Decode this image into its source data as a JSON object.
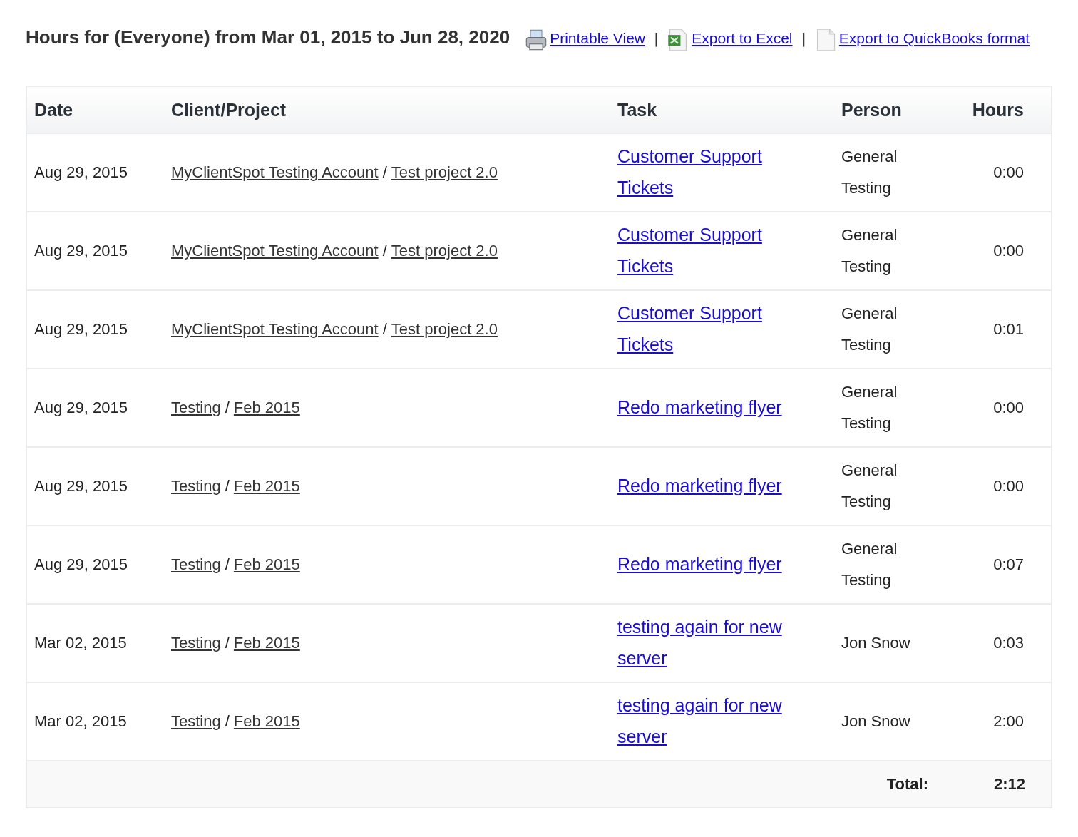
{
  "report": {
    "title": "Hours for (Everyone) from Mar 01, 2015 to Jun 28, 2020",
    "links": [
      {
        "kind": "print",
        "label": "Printable View"
      },
      {
        "kind": "excel",
        "label": "Export to Excel"
      },
      {
        "kind": "document",
        "label": "Export to QuickBooks format"
      }
    ],
    "separators": [
      "|",
      "|"
    ]
  },
  "table": {
    "columns": [
      "Date",
      "Client/Project",
      "Task",
      "Person",
      "Hours"
    ],
    "rows": [
      {
        "date": "Aug 29, 2015",
        "client": "MyClientSpot Testing Account",
        "slash": "/",
        "project": "Test project 2.0",
        "task": "Customer Support Tickets",
        "person": "General Testing",
        "hours": "0:00"
      },
      {
        "date": "Aug 29, 2015",
        "client": "MyClientSpot Testing Account",
        "slash": "/",
        "project": "Test project 2.0",
        "task": "Customer Support Tickets",
        "person": "General Testing",
        "hours": "0:00"
      },
      {
        "date": "Aug 29, 2015",
        "client": "MyClientSpot Testing Account",
        "slash": "/",
        "project": "Test project 2.0",
        "task": "Customer Support Tickets",
        "person": "General Testing",
        "hours": "0:01"
      },
      {
        "date": "Aug 29, 2015",
        "client": "Testing",
        "slash": "/",
        "project": "Feb 2015",
        "task": "Redo marketing flyer",
        "person": "General Testing",
        "hours": "0:00"
      },
      {
        "date": "Aug 29, 2015",
        "client": "Testing",
        "slash": "/",
        "project": "Feb 2015",
        "task": "Redo marketing flyer",
        "person": "General Testing",
        "hours": "0:00"
      },
      {
        "date": "Aug 29, 2015",
        "client": "Testing",
        "slash": "/",
        "project": "Feb 2015",
        "task": "Redo marketing flyer",
        "person": "General Testing",
        "hours": "0:07"
      },
      {
        "date": "Mar 02, 2015",
        "client": "Testing",
        "slash": "/",
        "project": "Feb 2015",
        "task": "testing again for new server",
        "person": "Jon Snow",
        "hours": "0:03"
      },
      {
        "date": "Mar 02, 2015",
        "client": "Testing",
        "slash": "/",
        "project": "Feb 2015",
        "task": "testing again for new server",
        "person": "Jon Snow",
        "hours": "2:00"
      }
    ],
    "total": {
      "label": "Total:",
      "value": "2:12"
    }
  }
}
